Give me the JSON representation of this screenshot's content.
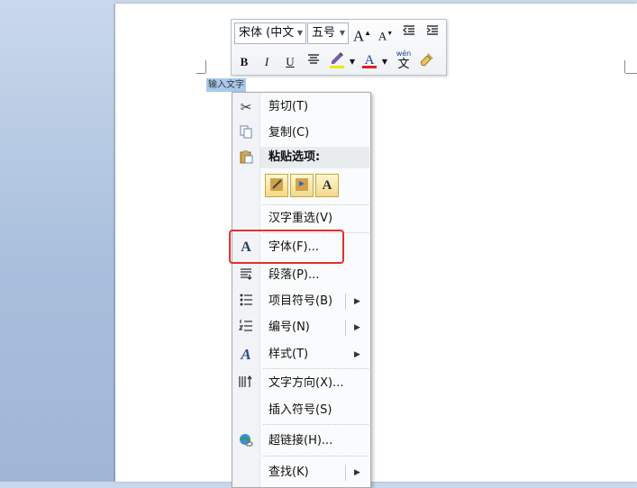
{
  "document": {
    "selected_text": "输入文字"
  },
  "mini_toolbar": {
    "font_name": "宋体 (中文",
    "font_size": "五号",
    "grow_font": "A",
    "shrink_font": "A",
    "bold": "B",
    "italic": "I",
    "underline": "U",
    "font_color": "A",
    "phonetic": "wén"
  },
  "context_menu": {
    "cut": "剪切(T)",
    "copy": "复制(C)",
    "paste_options": "粘贴选项:",
    "reconvert": "汉字重选(V)",
    "font": "字体(F)...",
    "paragraph": "段落(P)...",
    "bullets": "项目符号(B)",
    "numbering": "编号(N)",
    "styles": "样式(T)",
    "text_direction": "文字方向(X)...",
    "insert_symbol": "插入符号(S)",
    "hyperlink": "超链接(H)...",
    "find": "查找(K)"
  },
  "colors": {
    "highlight_box": "#e0312a",
    "selection": "#a8c9ec"
  }
}
